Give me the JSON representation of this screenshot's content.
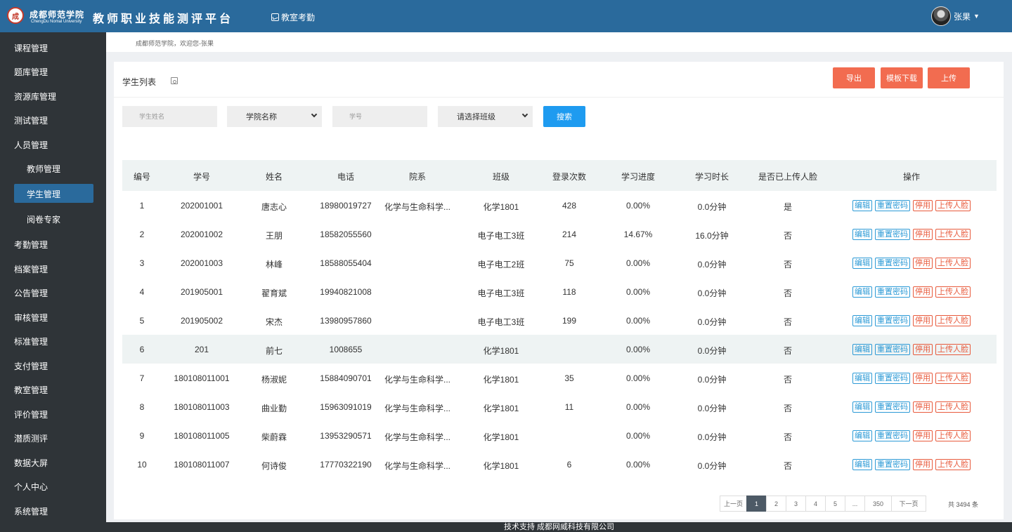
{
  "header": {
    "logo_glyph": "成",
    "university_name": "成都师范学院",
    "university_en": "ChengDu Nomal University",
    "platform_title": "教师职业技能测评平台",
    "nav_label": "教室考勤",
    "user_name": "张果"
  },
  "sidebar": {
    "items": [
      "课程管理",
      "题库管理",
      "资源库管理",
      "测试管理",
      "人员管理",
      "教师管理",
      "学生管理",
      "阅卷专家",
      "考勤管理",
      "档案管理",
      "公告管理",
      "审核管理",
      "标准管理",
      "支付管理",
      "教室管理",
      "评价管理",
      "潜质测评",
      "数据大屏",
      "个人中心",
      "系统管理"
    ]
  },
  "breadcrumb": "成都师范学院，欢迎您-张果",
  "panel": {
    "title": "学生列表",
    "buttons": {
      "export": "导出",
      "template": "模板下载",
      "upload": "上传"
    }
  },
  "filters": {
    "name_placeholder": "学生姓名",
    "college_select": "学院名称",
    "id_placeholder": "学号",
    "class_select": "请选择班级",
    "search_label": "搜索"
  },
  "table": {
    "headers": [
      "编号",
      "学号",
      "姓名",
      "电话",
      "院系",
      "班级",
      "登录次数",
      "学习进度",
      "学习时长",
      "是否已上传人脸",
      "操作"
    ],
    "rows": [
      [
        "1",
        "202001001",
        "唐志心",
        "18980019727",
        "化学与生命科学...",
        "化学1801",
        "428",
        "0.00%",
        "0.0分钟",
        "是"
      ],
      [
        "2",
        "202001002",
        "王朋",
        "18582055560",
        "",
        "电子电工3班",
        "214",
        "14.67%",
        "16.0分钟",
        "否"
      ],
      [
        "3",
        "202001003",
        "林峰",
        "18588055404",
        "",
        "电子电工2班",
        "75",
        "0.00%",
        "0.0分钟",
        "否"
      ],
      [
        "4",
        "201905001",
        "翟育斌",
        "19940821008",
        "",
        "电子电工3班",
        "118",
        "0.00%",
        "0.0分钟",
        "否"
      ],
      [
        "5",
        "201905002",
        "宋杰",
        "13980957860",
        "",
        "电子电工3班",
        "199",
        "0.00%",
        "0.0分钟",
        "否"
      ],
      [
        "6",
        "201",
        "前七",
        "1008655",
        "",
        "化学1801",
        "",
        "0.00%",
        "0.0分钟",
        "否"
      ],
      [
        "7",
        "180108011001",
        "杨淑妮",
        "15884090701",
        "化学与生命科学...",
        "化学1801",
        "35",
        "0.00%",
        "0.0分钟",
        "否"
      ],
      [
        "8",
        "180108011003",
        "曲业勤",
        "15963091019",
        "化学与生命科学...",
        "化学1801",
        "11",
        "0.00%",
        "0.0分钟",
        "否"
      ],
      [
        "9",
        "180108011005",
        "柴蔚霖",
        "13953290571",
        "化学与生命科学...",
        "化学1801",
        "",
        "0.00%",
        "0.0分钟",
        "否"
      ],
      [
        "10",
        "180108011007",
        "何诗俊",
        "17770322190",
        "化学与生命科学...",
        "化学1801",
        "6",
        "0.00%",
        "0.0分钟",
        "否"
      ]
    ],
    "actions": [
      "编辑",
      "重置密码",
      "停用",
      "上传人脸"
    ]
  },
  "pagination": {
    "prev": "上一页",
    "pages": [
      "1",
      "2",
      "3",
      "4",
      "5",
      "...",
      "350"
    ],
    "current": "1",
    "next": "下一页",
    "total": "共 3494 条"
  },
  "footer": "技术支持 成都网威科技有限公司",
  "colors": {
    "header": "#2a6a9c",
    "sidebar": "#2f3438",
    "action_orange": "#f26c50",
    "search_blue": "#1e9bf0",
    "action_blue": "#2c9ad6",
    "action_red": "#e85a3c"
  }
}
